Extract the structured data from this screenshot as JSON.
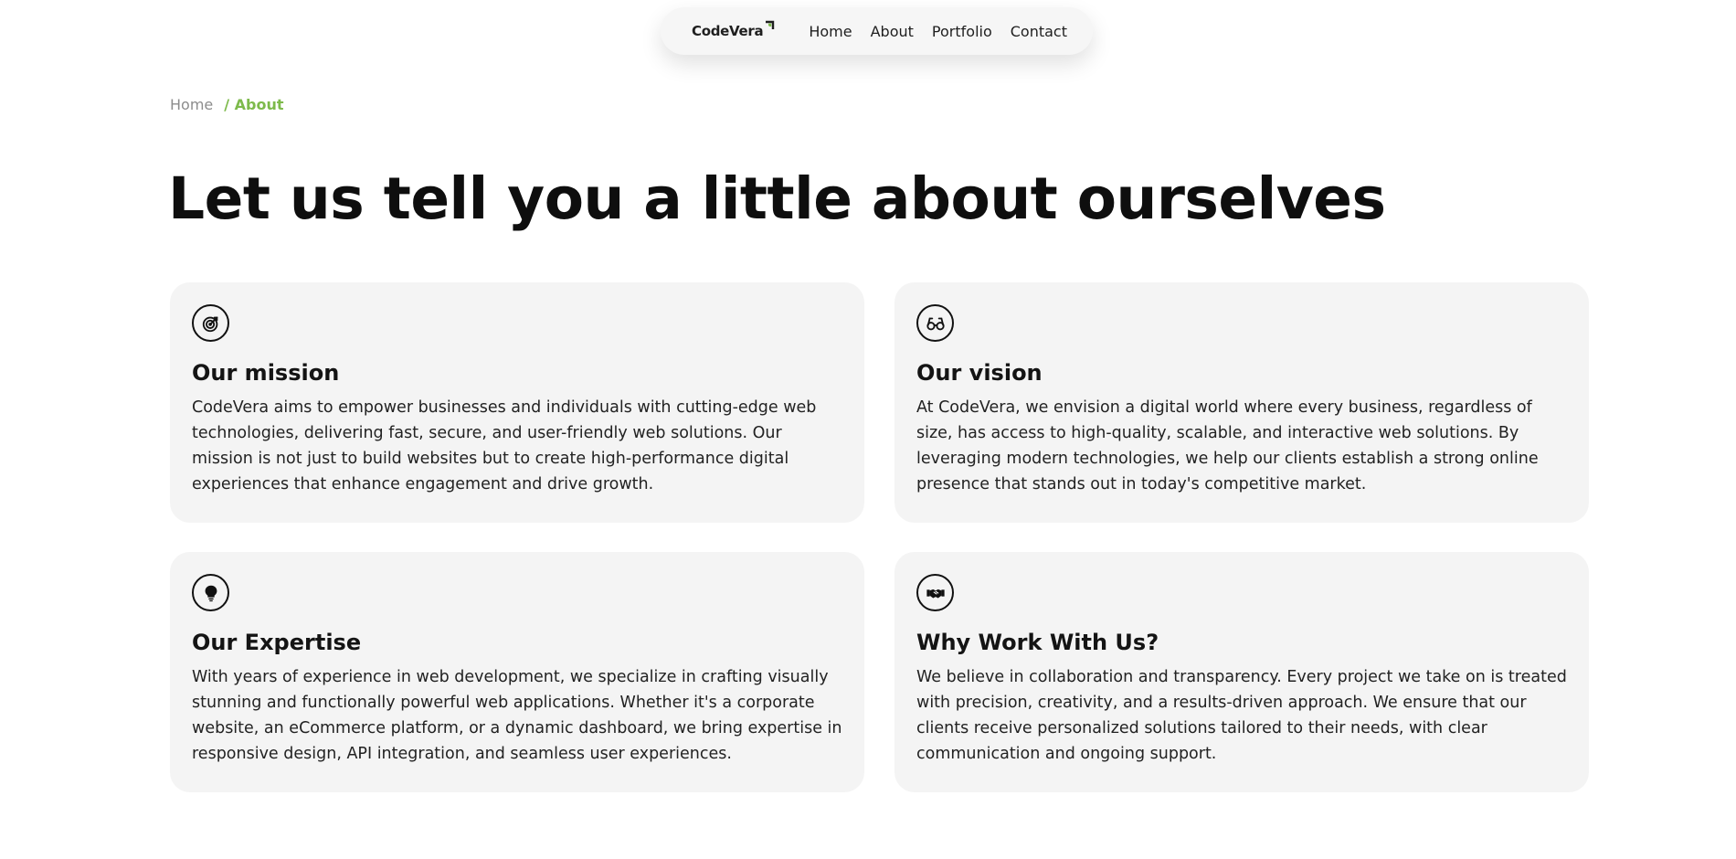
{
  "brand": {
    "name": "CodeVera",
    "accent_color": "#7dba4b"
  },
  "nav": {
    "items": [
      {
        "label": "Home"
      },
      {
        "label": "About"
      },
      {
        "label": "Portfolio"
      },
      {
        "label": "Contact"
      }
    ]
  },
  "breadcrumb": {
    "home": "Home",
    "current": "/ About"
  },
  "headline": "Let us tell you a little about ourselves",
  "cards": [
    {
      "icon": "target-icon",
      "title": "Our mission",
      "text": "CodeVera aims to empower businesses and individuals with cutting-edge web technologies, delivering fast, secure, and user-friendly web solutions. Our mission is not just to build websites but to create high-performance digital experiences that enhance engagement and drive growth."
    },
    {
      "icon": "glasses-icon",
      "title": "Our vision",
      "text": "At CodeVera, we envision a digital world where every business, regardless of size, has access to high-quality, scalable, and interactive web solutions. By leveraging modern technologies, we help our clients establish a strong online presence that stands out in today's competitive market."
    },
    {
      "icon": "lightbulb-icon",
      "title": "Our Expertise",
      "text": "With years of experience in web development, we specialize in crafting visually stunning and functionally powerful web applications. Whether it's a corporate website, an eCommerce platform, or a dynamic dashboard, we bring expertise in responsive design, API integration, and seamless user experiences."
    },
    {
      "icon": "handshake-icon",
      "title": "Why Work With Us?",
      "text": "We believe in collaboration and transparency. Every project we take on is treated with precision, creativity, and a results-driven approach. We ensure that our clients receive personalized solutions tailored to their needs, with clear communication and ongoing support."
    }
  ]
}
